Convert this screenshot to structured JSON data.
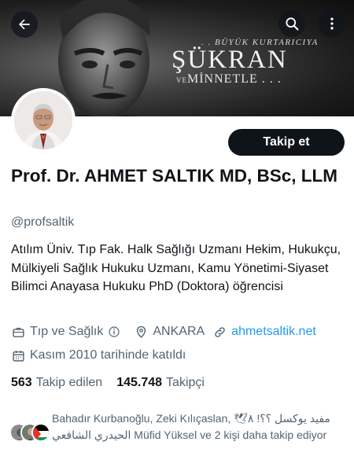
{
  "banner": {
    "line1": ". . BÜYÜK KURTARICIYA",
    "line2": "ŞÜKRAN",
    "line3_prefix": "VE",
    "line3": "MİNNETLE . . ."
  },
  "header": {
    "back_icon": "arrow-left-icon",
    "search_icon": "search-icon",
    "more_icon": "more-vertical-icon"
  },
  "profile": {
    "follow_label": "Takip et",
    "name": "Prof. Dr. AHMET SALTIK MD, BSc, LLM",
    "handle": "@profsaltik",
    "bio": "Atılım Üniv. Tıp Fak. Halk Sağlığı Uzmanı Hekim, Hukukçu, Mülkiyeli Sağlık Hukuku Uzmanı, Kamu Yönetimi-Siyaset Bilimci Anayasa Hukuku PhD (Doktora) öğrencisi",
    "category": "Tıp ve Sağlık",
    "location": "ANKARA",
    "website": "ahmetsaltik.net",
    "joined": "Kasım 2010 tarihinde katıldı"
  },
  "stats": {
    "following_count": "563",
    "following_label": "Takip edilen",
    "followers_count": "145.748",
    "followers_label": "Takipçi"
  },
  "followed_by": {
    "text": "Bahadır Kurbanoğlu, Zeki Kılıçaslan, مفيد يوكسل ؟⁦!؟⁩ ٨🕊 الحيدري الشافعي Müfid Yüksel ve 2 kişi daha takip ediyor"
  },
  "colors": {
    "accent_link": "#1d9bf0",
    "secondary_text": "#536471",
    "primary_text": "#0f1419",
    "follow_button": "#0f1419"
  }
}
